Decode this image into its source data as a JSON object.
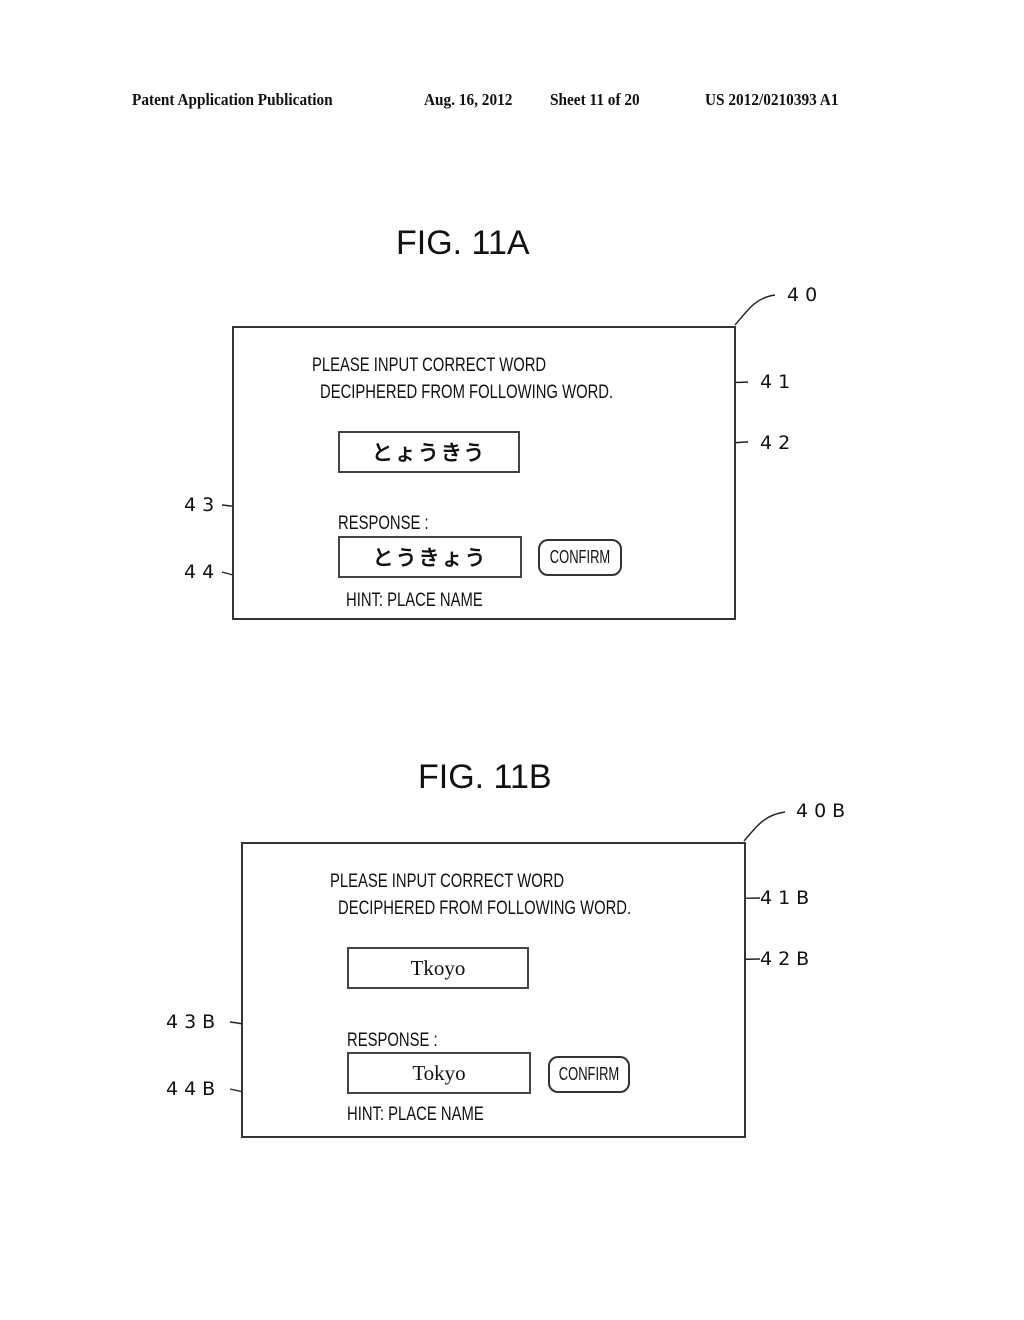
{
  "header": {
    "publication": "Patent Application Publication",
    "date": "Aug. 16, 2012",
    "sheet": "Sheet 11 of 20",
    "number": "US 2012/0210393 A1"
  },
  "figures": [
    {
      "title": "FIG. 11A",
      "panel_ref": "40",
      "instruction_line1": "PLEASE INPUT CORRECT WORD",
      "instruction_line2": "DECIPHERED FROM FOLLOWING WORD.",
      "instruction_ref": "41",
      "scrambled_word": "とょうきう",
      "scrambled_ref": "42",
      "response_label": "RESPONSE :",
      "response_value": "とうきょう",
      "response_ref": "43",
      "confirm_label": "CONFIRM",
      "hint": "HINT: PLACE NAME",
      "hint_ref": "44"
    },
    {
      "title": "FIG. 11B",
      "panel_ref": "40B",
      "instruction_line1": "PLEASE INPUT CORRECT WORD",
      "instruction_line2": "DECIPHERED FROM FOLLOWING WORD.",
      "instruction_ref": "41B",
      "scrambled_word": "Tkoyo",
      "scrambled_ref": "42B",
      "response_label": "RESPONSE :",
      "response_value": "Tokyo",
      "response_ref": "43B",
      "confirm_label": "CONFIRM",
      "hint": "HINT: PLACE NAME",
      "hint_ref": "44B"
    }
  ]
}
